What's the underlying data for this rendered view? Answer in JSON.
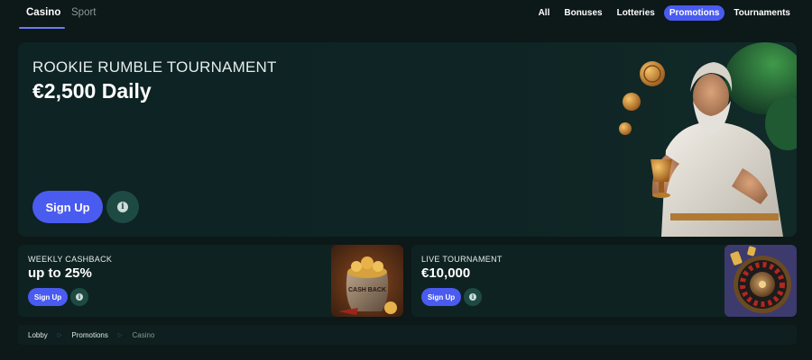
{
  "nav": {
    "categories": [
      {
        "label": "Casino",
        "active": true
      },
      {
        "label": "Sport",
        "active": false
      }
    ],
    "filters": [
      {
        "label": "All",
        "active": false
      },
      {
        "label": "Bonuses",
        "active": false
      },
      {
        "label": "Lotteries",
        "active": false
      },
      {
        "label": "Promotions",
        "active": true
      },
      {
        "label": "Tournaments",
        "active": false
      }
    ]
  },
  "hero": {
    "subtitle": "ROOKIE RUMBLE TOURNAMENT",
    "title": "€2,500 Daily",
    "cta_label": "Sign Up",
    "info_glyph": "i"
  },
  "cards": [
    {
      "subtitle": "WEEKLY CASHBACK",
      "title": "up to 25%",
      "cta_label": "Sign Up",
      "info_glyph": "i",
      "art_text": "CASH BACK"
    },
    {
      "subtitle": "LIVE TOURNAMENT",
      "title": "€10,000",
      "cta_label": "Sign Up",
      "info_glyph": "i"
    }
  ],
  "breadcrumb": {
    "items": [
      "Lobby",
      "Promotions",
      "Casino"
    ],
    "separator": "▷"
  },
  "colors": {
    "accent": "#4a5bf0",
    "background": "#0d1818",
    "card": "#0f2222",
    "info_button": "#1e4a44"
  }
}
